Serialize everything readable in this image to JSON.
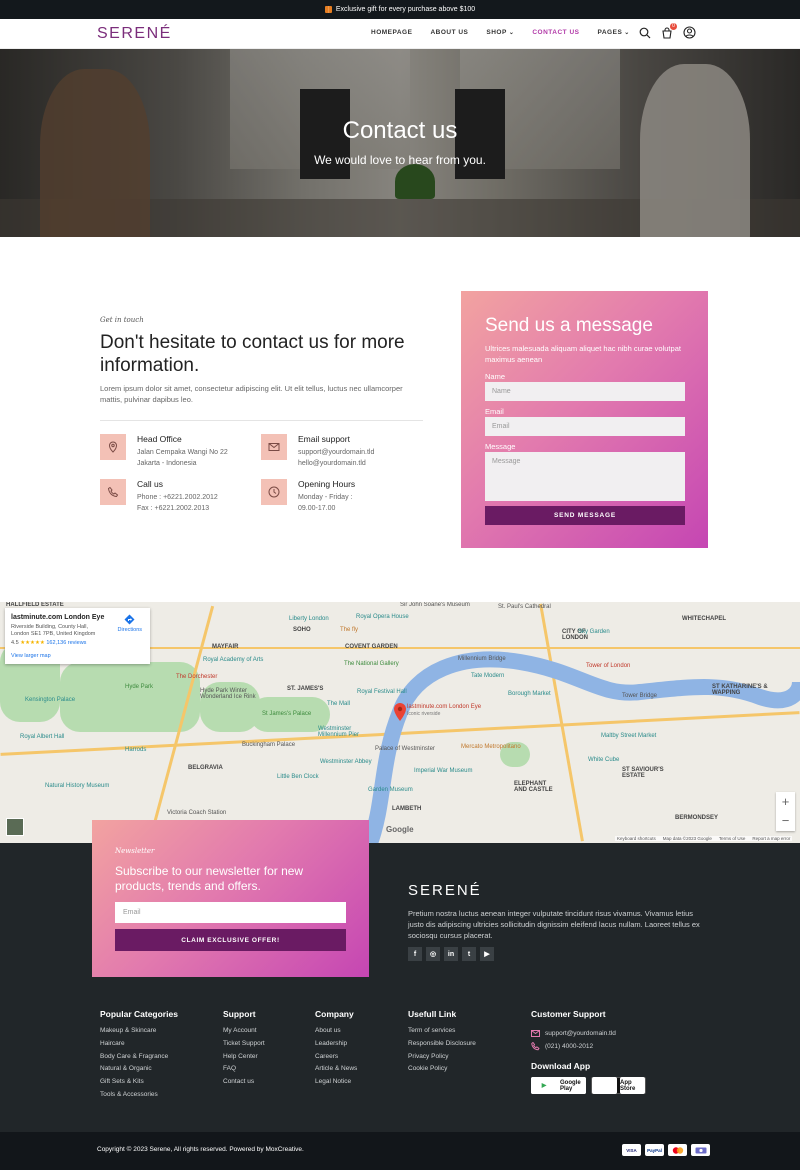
{
  "topbar": {
    "text": "Exclusive gift for every purchase above $100",
    "icon": "gift-icon"
  },
  "header": {
    "logo": "SERENÉ",
    "nav": [
      {
        "label": "HOMEPAGE"
      },
      {
        "label": "ABOUT US"
      },
      {
        "label": "SHOP",
        "dropdown": true
      },
      {
        "label": "CONTACT US",
        "active": true
      },
      {
        "label": "PAGES",
        "dropdown": true
      }
    ],
    "cart_count": "0"
  },
  "hero": {
    "title": "Contact us",
    "subtitle": "We would love to hear from you."
  },
  "contact": {
    "eyebrow": "Get in touch",
    "headline": "Don't hesitate to contact us for more information.",
    "lead": "Lorem ipsum dolor sit amet, consectetur adipiscing elit. Ut elit tellus, luctus nec ullamcorper mattis, pulvinar dapibus leo.",
    "items": [
      {
        "title": "Head Office",
        "lines": [
          "Jalan Cempaka Wangi No 22",
          "Jakarta - Indonesia"
        ],
        "icon": "map-pin-icon"
      },
      {
        "title": "Email support",
        "lines": [
          "support@yourdomain.tld",
          "hello@yourdomain.tld"
        ],
        "icon": "envelope-icon"
      },
      {
        "title": "Call us",
        "lines": [
          "Phone : +6221.2002.2012",
          "Fax : +6221.2002.2013"
        ],
        "icon": "phone-icon"
      },
      {
        "title": "Opening Hours",
        "lines": [
          "Monday - Friday :",
          "09.00-17.00"
        ],
        "icon": "clock-icon"
      }
    ]
  },
  "form": {
    "title": "Send us a message",
    "description": "Ultrices malesuada aliquam aliquet hac nibh curae volutpat maximus aenean",
    "name_label": "Name",
    "name_placeholder": "Name",
    "email_label": "Email",
    "email_placeholder": "Email",
    "message_label": "Message",
    "message_placeholder": "Message",
    "submit": "SEND MESSAGE"
  },
  "map": {
    "place_name": "lastminute.com London Eye",
    "address": "Riverside Building, County Hall, London SE1 7PB, United Kingdom",
    "rating": "4.5",
    "stars": "★★★★★",
    "reviews": "162,136 reviews",
    "directions": "Directions",
    "larger_map": "View larger map",
    "pin_label": "lastminute.com London Eye",
    "pin_sub": "Iconic riverside",
    "labels": {
      "hatfield": "HALLFIELD ESTATE",
      "mayfair": "MAYFAIR",
      "soho": "SOHO",
      "covent": "COVENT GARDEN",
      "stjames": "ST. JAMES'S",
      "belgravia": "BELGRAVIA",
      "lambeth": "LAMBETH",
      "cityoflondon": "CITY OF LONDON",
      "whitechapel": "WHITECHAPEL",
      "stkath": "ST KATHARINE'S & WAPPING",
      "stsav": "ST SAVIOUR'S ESTATE",
      "bermondsey": "BERMONDSEY",
      "elephant": "ELEPHANT AND CASTLE",
      "hydepark": "Hyde Park",
      "kensington": "Kensington Palace",
      "royalalbert": "Royal Albert Hall",
      "harrods": "Harrods",
      "nhm": "Natural History Museum",
      "victoria": "Victoria Coach Station",
      "buckingham": "Buckingham Palace",
      "bigben": "Little Ben Clock",
      "westminster": "Westminster Abbey",
      "parliament": "Palace of Westminster",
      "imperial": "Imperial War Museum",
      "garden": "Garden Museum",
      "mercato": "Mercato Metropolitano",
      "borough": "Borough Market",
      "tate": "Tate Modern",
      "millennium": "Millennium Bridge",
      "towerbridge": "Tower Bridge",
      "toweroflondon": "Tower of London",
      "skygarden": "Sky Garden",
      "stpauls": "St. Paul's Cathedral",
      "soane": "Sir John Soane's Museum",
      "liberty": "Liberty London",
      "royalopera": "Royal Opera House",
      "royalacademy": "Royal Academy of Arts",
      "nationalgallery": "The National Gallery",
      "royalfestival": "Royal Festival Hall",
      "themall": "The Mall",
      "stjamespalace": "St James's Palace",
      "dorchester": "The Dorchester",
      "hydeparkwinter": "Hyde Park Winter Wonderland Ice Rink",
      "westminsterbridge": "Westminster Millennium Pier",
      "whitecube": "White Cube",
      "maltby": "Maltby Street Market",
      "thefly": "The fly"
    },
    "footer_links": [
      "Keyboard shortcuts",
      "Map data ©2023 Google",
      "Terms of Use",
      "Report a map error"
    ],
    "google": "Google"
  },
  "newsletter": {
    "eyebrow": "Newsletter",
    "headline": "Subscribe to our newsletter for new products, trends and offers.",
    "placeholder": "Email",
    "button": "CLAIM EXCLUSIVE OFFER!"
  },
  "footer": {
    "logo": "SERENÉ",
    "description": "Pretium nostra luctus aenean integer vulputate tincidunt risus vivamus. Vivamus letius justo dis adipiscing ultricies sollicitudin dignissim eleifend lacus nullam. Laoreet tellus ex sociosqu cursus placerat.",
    "social": [
      "facebook-icon",
      "instagram-icon",
      "linkedin-icon",
      "twitter-icon",
      "youtube-icon"
    ],
    "columns": [
      {
        "title": "Popular Categories",
        "links": [
          "Makeup & Skincare",
          "Haircare",
          "Body Care & Fragrance",
          "Natural & Organic",
          "Gift Sets & Kits",
          "Tools & Accessories"
        ]
      },
      {
        "title": "Support",
        "links": [
          "My Account",
          "Ticket Support",
          "Help Center",
          "FAQ",
          "Contact us"
        ]
      },
      {
        "title": "Company",
        "links": [
          "About us",
          "Leadership",
          "Careers",
          "Article & News",
          "Legal Notice"
        ]
      },
      {
        "title": "Usefull Link",
        "links": [
          "Term of services",
          "Responsible Disclosure",
          "Privacy Policy",
          "Cookie Policy"
        ]
      }
    ],
    "customer_support": {
      "title": "Customer Support",
      "email": "support@yourdomain.tld",
      "phone": "(021) 4000-2012"
    },
    "download": {
      "title": "Download App",
      "google_play": "Google Play",
      "app_store": "App Store"
    },
    "copyright": "Copyright © 2023 Serene, All rights reserved. Powered by MoxCreative.",
    "payments": [
      "VISA",
      "PayPal",
      "MC",
      "CARD"
    ]
  },
  "colors": {
    "accent": "#b23aa8",
    "deep_purple": "#6a1b63",
    "footer_bg": "#212629",
    "icon_tile": "#f3c1b6"
  }
}
